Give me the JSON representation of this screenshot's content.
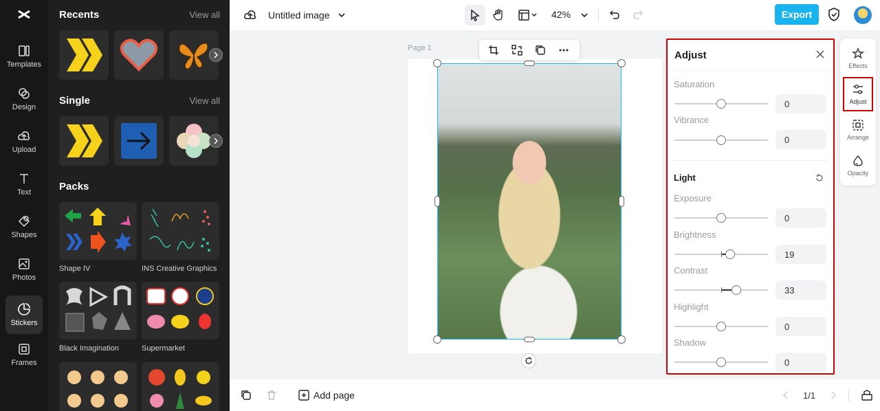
{
  "rail": {
    "items": [
      {
        "label": "Templates",
        "icon": "templates-icon"
      },
      {
        "label": "Design",
        "icon": "design-icon"
      },
      {
        "label": "Upload",
        "icon": "upload-icon"
      },
      {
        "label": "Text",
        "icon": "text-icon"
      },
      {
        "label": "Shapes",
        "icon": "shapes-icon"
      },
      {
        "label": "Photos",
        "icon": "photos-icon"
      },
      {
        "label": "Stickers",
        "icon": "stickers-icon",
        "active": true
      },
      {
        "label": "Frames",
        "icon": "frames-icon"
      }
    ]
  },
  "panel": {
    "recents": {
      "title": "Recents",
      "view_all": "View all"
    },
    "single": {
      "title": "Single",
      "view_all": "View all"
    },
    "packs": {
      "title": "Packs",
      "items": [
        {
          "label": "Shape IV"
        },
        {
          "label": "INS Creative Graphics"
        },
        {
          "label": "Black Imagination"
        },
        {
          "label": "Supermarket"
        }
      ]
    }
  },
  "topbar": {
    "doc_title": "Untitled image",
    "zoom": "42%",
    "export_label": "Export"
  },
  "canvas": {
    "page_label": "Page 1"
  },
  "adjust": {
    "title": "Adjust",
    "sliders_top": [
      {
        "label": "Saturation",
        "value": "0"
      },
      {
        "label": "Vibrance",
        "value": "0"
      }
    ],
    "light_title": "Light",
    "sliders_light": [
      {
        "label": "Exposure",
        "value": "0"
      },
      {
        "label": "Brightness",
        "value": "19"
      },
      {
        "label": "Contrast",
        "value": "33"
      },
      {
        "label": "Highlight",
        "value": "0"
      },
      {
        "label": "Shadow",
        "value": "0"
      }
    ]
  },
  "right_tabs": [
    {
      "label": "Effects",
      "icon": "effects-icon"
    },
    {
      "label": "Adjust",
      "icon": "adjust-icon",
      "selected": true
    },
    {
      "label": "Arrange",
      "icon": "arrange-icon"
    },
    {
      "label": "Opacity",
      "icon": "opacity-icon"
    }
  ],
  "bottombar": {
    "add_page": "Add page",
    "pager": "1/1"
  },
  "colors": {
    "accent": "#19b4ef",
    "highlight_border": "#d60000",
    "rail_bg": "#171717",
    "panel_bg": "#1f1f1f"
  }
}
